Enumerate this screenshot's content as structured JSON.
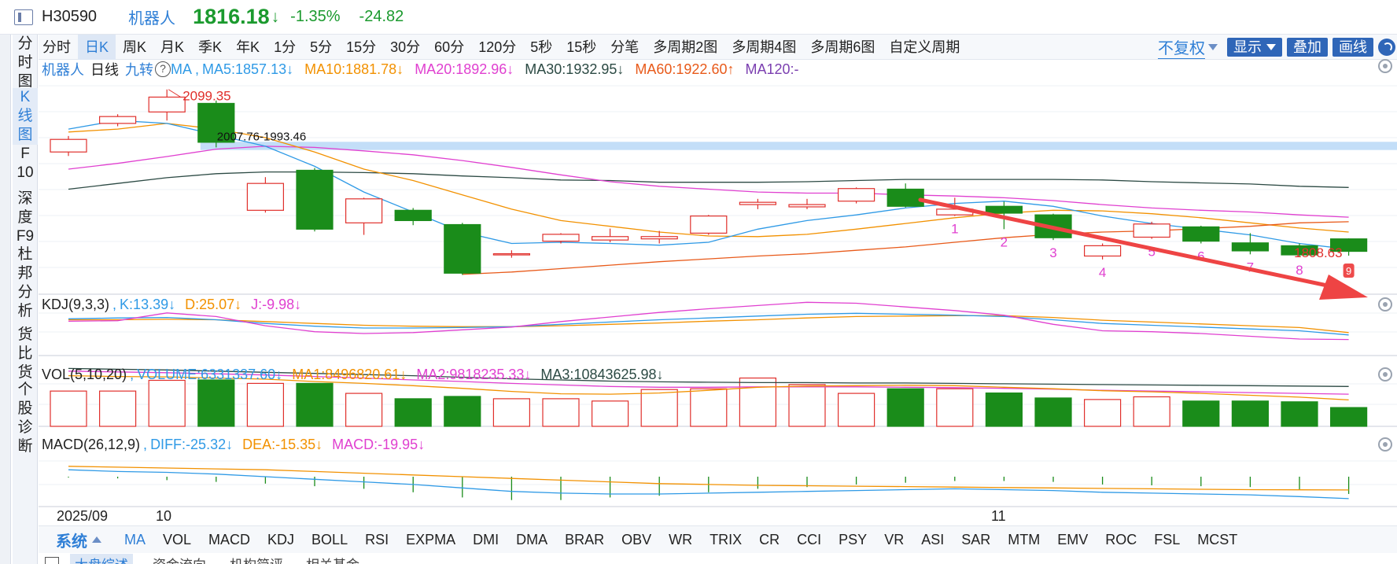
{
  "header": {
    "code": "H30590",
    "name": "机器人",
    "price": "1816.18",
    "arrow": "↓",
    "change_pct": "-1.35%",
    "change_amt": "-24.82"
  },
  "sidebar": {
    "items": [
      {
        "label": "分时图",
        "chars": [
          "分",
          "时",
          "图"
        ]
      },
      {
        "label": "K线图",
        "chars": [
          "K",
          "线",
          "图"
        ]
      },
      {
        "label": "F10",
        "chars": [
          "F",
          "10"
        ]
      },
      {
        "label": "深度F9",
        "chars": [
          "深",
          "度",
          "F9"
        ]
      },
      {
        "label": "杜邦分析",
        "chars": [
          "杜",
          "邦",
          "分",
          "析"
        ]
      },
      {
        "label": "货比货",
        "chars": [
          "货",
          "比",
          "货"
        ]
      },
      {
        "label": "个股诊断",
        "chars": [
          "个",
          "股",
          "诊",
          "断"
        ]
      }
    ],
    "active_index": 1
  },
  "period_tabs": [
    "分时",
    "日K",
    "周K",
    "月K",
    "季K",
    "年K",
    "1分",
    "5分",
    "15分",
    "30分",
    "60分",
    "120分",
    "5秒",
    "15秒",
    "分笔",
    "多周期2图",
    "多周期4图",
    "多周期6图",
    "自定义周期"
  ],
  "period_active": 1,
  "toolbar": {
    "fuquan": "不复权",
    "display": "显示",
    "overlay": "叠加",
    "draw": "画线"
  },
  "main_legend": {
    "name": "机器人",
    "period": "日线",
    "jiuzhuan": "九转",
    "ma_title": "MA",
    "ma5": "MA5:1857.13↓",
    "ma10": "MA10:1881.78↓",
    "ma20": "MA20:1892.96↓",
    "ma30": "MA30:1932.95↓",
    "ma60": "MA60:1922.60↑",
    "ma120": "MA120:-"
  },
  "kdj_legend": {
    "title": "KDJ(9,3,3)",
    "k": "K:13.39↓",
    "d": "D:25.07↓",
    "j": "J:-9.98↓"
  },
  "vol_legend": {
    "title": "VOL(5,10,20)",
    "volume": "VOLUME:6331337.60↓",
    "ma1": "MA1:8496820.61↓",
    "ma2": "MA2:9818235.33↓",
    "ma3": "MA3:10843625.98↓"
  },
  "macd_legend": {
    "title": "MACD(26,12,9)",
    "diff": "DIFF:-25.32↓",
    "dea": "DEA:-15.35↓",
    "macd": "MACD:-19.95↓"
  },
  "annotations": {
    "high_label": "2099.35",
    "low_label": "1808.63",
    "range_label": "2007.76-1993.46",
    "nine_count": [
      "1",
      "2",
      "3",
      "4",
      "5",
      "6",
      "7",
      "8",
      "9"
    ]
  },
  "dates": {
    "first": "2025/09",
    "oct": "10",
    "nov": "11"
  },
  "indicator_tabs": [
    "MA",
    "VOL",
    "MACD",
    "KDJ",
    "BOLL",
    "RSI",
    "EXPMA",
    "DMI",
    "DMA",
    "BRAR",
    "OBV",
    "WR",
    "TRIX",
    "CR",
    "CCI",
    "PSY",
    "VR",
    "ASI",
    "SAR",
    "MTM",
    "EMV",
    "ROC",
    "FSL",
    "MCST"
  ],
  "indicator_active": 0,
  "system_label": "系统",
  "bottom_tabs": [
    "大盘综述",
    "资金流向",
    "机构简评",
    "相关基金"
  ],
  "colors": {
    "up": "#e0302c",
    "down": "#1a8c1a",
    "ma5": "#2f9ae6",
    "ma10": "#f29100",
    "ma20": "#e040d0",
    "ma30": "#2c4a44",
    "ma60": "#e85a1a",
    "ma120": "#7b3fb0",
    "accent": "#2f7fd6",
    "arrow": "#ee4444",
    "band": "#b9d8f7"
  },
  "chart_data": {
    "type": "candlestick",
    "candles": [
      {
        "o": 1990,
        "c": 2012,
        "h": 2018,
        "l": 1983
      },
      {
        "o": 2040,
        "c": 2052,
        "h": 2056,
        "l": 2035
      },
      {
        "o": 2060,
        "c": 2086,
        "h": 2099.35,
        "l": 2045
      },
      {
        "o": 2075,
        "c": 2007,
        "h": 2080,
        "l": 1998
      },
      {
        "o": 1888,
        "c": 1935,
        "h": 1946,
        "l": 1884
      },
      {
        "o": 1958,
        "c": 1855,
        "h": 1962,
        "l": 1851
      },
      {
        "o": 1866,
        "c": 1908,
        "h": 1910,
        "l": 1845
      },
      {
        "o": 1888,
        "c": 1870,
        "h": 1892,
        "l": 1862
      },
      {
        "o": 1863,
        "c": 1778,
        "h": 1866,
        "l": 1775
      },
      {
        "o": 1812,
        "c": 1812,
        "h": 1818,
        "l": 1805
      },
      {
        "o": 1834,
        "c": 1846,
        "h": 1848,
        "l": 1830
      },
      {
        "o": 1836,
        "c": 1842,
        "h": 1856,
        "l": 1832
      },
      {
        "o": 1838,
        "c": 1842,
        "h": 1852,
        "l": 1830
      },
      {
        "o": 1848,
        "c": 1878,
        "h": 1880,
        "l": 1845
      },
      {
        "o": 1898,
        "c": 1902,
        "h": 1908,
        "l": 1890
      },
      {
        "o": 1894,
        "c": 1898,
        "h": 1908,
        "l": 1890
      },
      {
        "o": 1904,
        "c": 1926,
        "h": 1928,
        "l": 1900
      },
      {
        "o": 1925,
        "c": 1895,
        "h": 1935,
        "l": 1893
      },
      {
        "o": 1880,
        "c": 1890,
        "h": 1910,
        "l": 1878
      },
      {
        "o": 1895,
        "c": 1883,
        "h": 1903,
        "l": 1855
      },
      {
        "o": 1880,
        "c": 1840,
        "h": 1882,
        "l": 1836
      },
      {
        "o": 1808,
        "c": 1826,
        "h": 1830,
        "l": 1802
      },
      {
        "o": 1841,
        "c": 1864,
        "h": 1868,
        "l": 1838
      },
      {
        "o": 1859,
        "c": 1834,
        "h": 1861,
        "l": 1830
      },
      {
        "o": 1831,
        "c": 1817,
        "h": 1848,
        "l": 1811
      },
      {
        "o": 1826,
        "c": 1810,
        "h": 1830,
        "l": 1806
      },
      {
        "o": 1838,
        "c": 1816.18,
        "h": 1839,
        "l": 1808.63
      }
    ],
    "ma5": [
      2030,
      2045,
      2040,
      2020,
      2000,
      1965,
      1920,
      1885,
      1850,
      1830,
      1832,
      1830,
      1827,
      1832,
      1855,
      1870,
      1880,
      1892,
      1900,
      1904,
      1895,
      1878,
      1865,
      1855,
      1845,
      1830,
      1820
    ],
    "ma10": [
      2025,
      2030,
      2040,
      2030,
      2015,
      1990,
      1960,
      1940,
      1915,
      1890,
      1870,
      1860,
      1850,
      1843,
      1842,
      1846,
      1855,
      1865,
      1875,
      1883,
      1888,
      1887,
      1882,
      1875,
      1866,
      1857,
      1850
    ],
    "ma20": [
      1960,
      1970,
      1982,
      1995,
      2000,
      1998,
      1992,
      1985,
      1975,
      1963,
      1950,
      1938,
      1930,
      1925,
      1920,
      1918,
      1918,
      1915,
      1913,
      1910,
      1905,
      1898,
      1892,
      1888,
      1885,
      1880,
      1876
    ],
    "ma30": [
      1925,
      1935,
      1945,
      1952,
      1955,
      1955,
      1954,
      1952,
      1948,
      1945,
      1941,
      1940,
      1937,
      1937,
      1937,
      1938,
      1940,
      1942,
      1942,
      1942,
      1942,
      1941,
      1938,
      1936,
      1934,
      1930,
      1928
    ],
    "ma60": [
      null,
      null,
      null,
      null,
      null,
      null,
      null,
      null,
      1776,
      1780,
      1786,
      1792,
      1798,
      1803,
      1808,
      1812,
      1818,
      1824,
      1832,
      1840,
      1846,
      1850,
      1852,
      1856,
      1860,
      1866,
      1868
    ],
    "band": [
      2007.76,
      1993.46
    ],
    "kdj": {
      "k": [
        60,
        62,
        63,
        58,
        50,
        44,
        40,
        40,
        41,
        43,
        48,
        53,
        58,
        62,
        66,
        70,
        72,
        70,
        68,
        65,
        58,
        50,
        46,
        42,
        38,
        34,
        25
      ],
      "d": [
        58,
        58,
        59,
        58,
        54,
        50,
        46,
        44,
        43,
        43,
        45,
        48,
        51,
        55,
        58,
        62,
        65,
        66,
        67,
        67,
        63,
        57,
        53,
        49,
        45,
        41,
        30
      ],
      "j": [
        55,
        56,
        73,
        65,
        45,
        32,
        28,
        30,
        36,
        42,
        54,
        64,
        74,
        82,
        89,
        96,
        94,
        86,
        78,
        68,
        48,
        34,
        32,
        28,
        22,
        16,
        15
      ]
    },
    "volume": [
      9.2,
      9.2,
      12.0,
      12.1,
      11.2,
      11.2,
      8.6,
      7.2,
      7.8,
      7.2,
      7.2,
      6.6,
      9.6,
      9.8,
      12.6,
      10.9,
      8.6,
      9.8,
      9.8,
      8.7,
      7.4,
      7.0,
      7.7,
      6.6,
      6.6,
      6.4,
      4.9
    ],
    "vol_ma": {
      "ma1": [
        13.2,
        13.0,
        12.9,
        12.6,
        12.3,
        11.7,
        11.2,
        10.6,
        9.9,
        9.1,
        8.5,
        8.4,
        8.7,
        9.4,
        10.2,
        10.5,
        10.6,
        10.7,
        10.6,
        10.2,
        9.8,
        9.3,
        9.0,
        8.6,
        8.1,
        7.6,
        6.9
      ],
      "ma2": [
        14.4,
        14.2,
        14.0,
        13.7,
        13.4,
        13.0,
        12.6,
        12.1,
        11.7,
        11.2,
        10.8,
        10.4,
        10.2,
        10.2,
        10.3,
        10.3,
        10.3,
        10.2,
        10.1,
        9.9,
        9.7,
        9.4,
        9.2,
        9.0,
        8.8,
        8.6,
        8.4
      ],
      "ma3": [
        15.1,
        14.9,
        14.7,
        14.4,
        14.1,
        13.8,
        13.5,
        13.2,
        12.8,
        12.4,
        12.1,
        11.8,
        11.6,
        11.5,
        11.4,
        11.4,
        11.3,
        11.3,
        11.2,
        11.1,
        11.0,
        10.9,
        10.8,
        10.7,
        10.6,
        10.5,
        10.4
      ]
    },
    "macd": {
      "diff": [
        8,
        6,
        5,
        3,
        0,
        -3,
        -6,
        -9,
        -13,
        -17,
        -19,
        -20,
        -20,
        -19,
        -18,
        -17,
        -16,
        -15,
        -14,
        -15,
        -16,
        -18,
        -19,
        -20,
        -21,
        -23,
        -25.32
      ],
      "dea": [
        12,
        11,
        10,
        9,
        8,
        6,
        4,
        2,
        0,
        -2,
        -4,
        -6,
        -8,
        -9,
        -10,
        -10.5,
        -11,
        -11.5,
        -12,
        -12.5,
        -13,
        -13.5,
        -14,
        -14.5,
        -15,
        -15.2,
        -15.35
      ],
      "hist": [
        -1,
        -2,
        -4,
        -6,
        -8,
        -11,
        -14,
        -18,
        -24,
        -27,
        -27,
        -24,
        -22,
        -18,
        -14,
        -12,
        -9,
        -7,
        -5,
        -5,
        -6,
        -9,
        -10,
        -11,
        -12,
        -15,
        -19.95
      ]
    }
  }
}
